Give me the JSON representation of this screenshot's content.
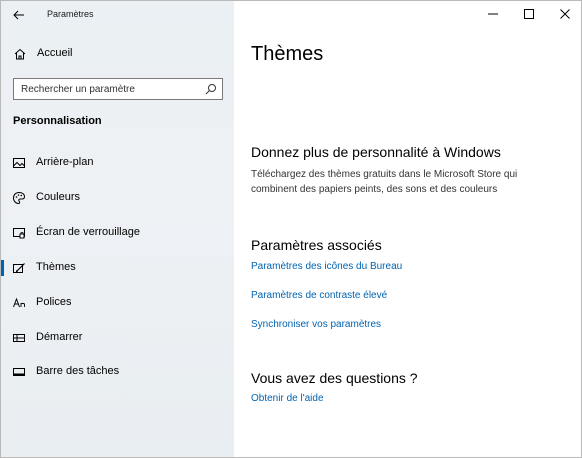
{
  "window": {
    "title": "Paramètres",
    "controls": [
      "minimize",
      "maximize",
      "close"
    ]
  },
  "sidebar": {
    "home_label": "Accueil",
    "search_placeholder": "Rechercher un paramètre",
    "section_title": "Personnalisation",
    "items": [
      {
        "label": "Arrière-plan",
        "icon": "picture-icon",
        "selected": false
      },
      {
        "label": "Couleurs",
        "icon": "palette-icon",
        "selected": false
      },
      {
        "label": "Écran de verrouillage",
        "icon": "lock-screen-icon",
        "selected": false
      },
      {
        "label": "Thèmes",
        "icon": "brush-icon",
        "selected": true
      },
      {
        "label": "Polices",
        "icon": "font-icon",
        "selected": false
      },
      {
        "label": "Démarrer",
        "icon": "start-icon",
        "selected": false
      },
      {
        "label": "Barre des tâches",
        "icon": "taskbar-icon",
        "selected": false
      }
    ]
  },
  "main": {
    "title": "Thèmes",
    "personalize": {
      "heading": "Donnez plus de personnalité à Windows",
      "line1": "Téléchargez des thèmes gratuits dans le Microsoft Store qui",
      "line2": "combinent des papiers peints, des sons et des couleurs"
    },
    "related": {
      "heading": "Paramètres associés",
      "links": [
        "Paramètres des icônes du Bureau",
        "Paramètres de contraste élevé",
        "Synchroniser vos paramètres"
      ]
    },
    "questions": {
      "heading": "Vous avez des questions ?",
      "link": "Obtenir de l'aide"
    }
  },
  "colors": {
    "accent": "#0063b1",
    "sidebar_bg": "#eaf0f3"
  }
}
